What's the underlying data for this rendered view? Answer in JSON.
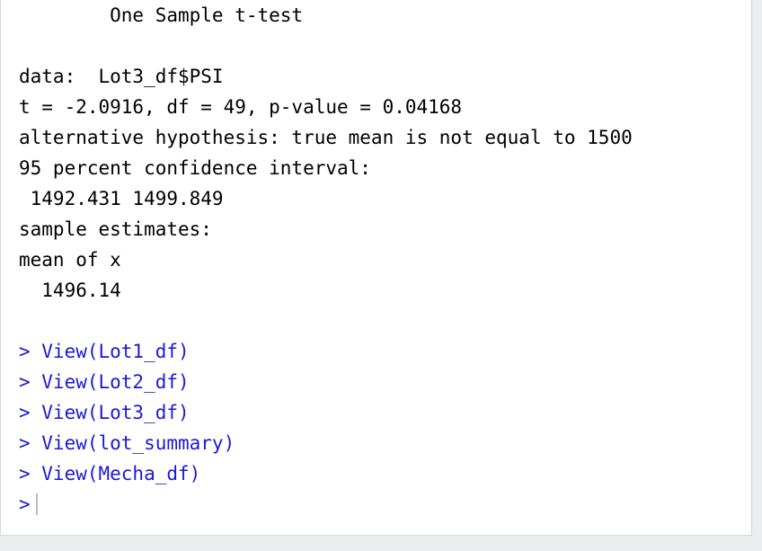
{
  "output": {
    "title": "        One Sample t-test",
    "blank1": "",
    "data_line": "data:  Lot3_df$PSI",
    "stats_line": "t = -2.0916, df = 49, p-value = 0.04168",
    "alt_line": "alternative hypothesis: true mean is not equal to 1500",
    "ci_label": "95 percent confidence interval:",
    "ci_values": " 1492.431 1499.849",
    "estimates_label": "sample estimates:",
    "mean_label": "mean of x",
    "mean_value": "  1496.14",
    "blank2": ""
  },
  "history": [
    "> View(Lot1_df)",
    "> View(Lot2_df)",
    "> View(Lot3_df)",
    "> View(lot_summary)",
    "> View(Mecha_df)"
  ],
  "prompt": ">"
}
